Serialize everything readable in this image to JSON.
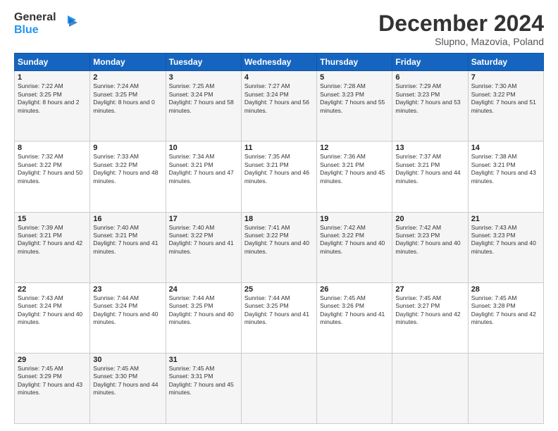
{
  "header": {
    "logo_line1": "General",
    "logo_line2": "Blue",
    "month_title": "December 2024",
    "subtitle": "Slupno, Mazovia, Poland"
  },
  "days_of_week": [
    "Sunday",
    "Monday",
    "Tuesday",
    "Wednesday",
    "Thursday",
    "Friday",
    "Saturday"
  ],
  "weeks": [
    [
      {
        "day": 1,
        "sunrise": "7:22 AM",
        "sunset": "3:25 PM",
        "daylight": "8 hours and 2 minutes."
      },
      {
        "day": 2,
        "sunrise": "7:24 AM",
        "sunset": "3:25 PM",
        "daylight": "8 hours and 0 minutes."
      },
      {
        "day": 3,
        "sunrise": "7:25 AM",
        "sunset": "3:24 PM",
        "daylight": "7 hours and 58 minutes."
      },
      {
        "day": 4,
        "sunrise": "7:27 AM",
        "sunset": "3:24 PM",
        "daylight": "7 hours and 56 minutes."
      },
      {
        "day": 5,
        "sunrise": "7:28 AM",
        "sunset": "3:23 PM",
        "daylight": "7 hours and 55 minutes."
      },
      {
        "day": 6,
        "sunrise": "7:29 AM",
        "sunset": "3:23 PM",
        "daylight": "7 hours and 53 minutes."
      },
      {
        "day": 7,
        "sunrise": "7:30 AM",
        "sunset": "3:22 PM",
        "daylight": "7 hours and 51 minutes."
      }
    ],
    [
      {
        "day": 8,
        "sunrise": "7:32 AM",
        "sunset": "3:22 PM",
        "daylight": "7 hours and 50 minutes."
      },
      {
        "day": 9,
        "sunrise": "7:33 AM",
        "sunset": "3:22 PM",
        "daylight": "7 hours and 48 minutes."
      },
      {
        "day": 10,
        "sunrise": "7:34 AM",
        "sunset": "3:21 PM",
        "daylight": "7 hours and 47 minutes."
      },
      {
        "day": 11,
        "sunrise": "7:35 AM",
        "sunset": "3:21 PM",
        "daylight": "7 hours and 46 minutes."
      },
      {
        "day": 12,
        "sunrise": "7:36 AM",
        "sunset": "3:21 PM",
        "daylight": "7 hours and 45 minutes."
      },
      {
        "day": 13,
        "sunrise": "7:37 AM",
        "sunset": "3:21 PM",
        "daylight": "7 hours and 44 minutes."
      },
      {
        "day": 14,
        "sunrise": "7:38 AM",
        "sunset": "3:21 PM",
        "daylight": "7 hours and 43 minutes."
      }
    ],
    [
      {
        "day": 15,
        "sunrise": "7:39 AM",
        "sunset": "3:21 PM",
        "daylight": "7 hours and 42 minutes."
      },
      {
        "day": 16,
        "sunrise": "7:40 AM",
        "sunset": "3:21 PM",
        "daylight": "7 hours and 41 minutes."
      },
      {
        "day": 17,
        "sunrise": "7:40 AM",
        "sunset": "3:22 PM",
        "daylight": "7 hours and 41 minutes."
      },
      {
        "day": 18,
        "sunrise": "7:41 AM",
        "sunset": "3:22 PM",
        "daylight": "7 hours and 40 minutes."
      },
      {
        "day": 19,
        "sunrise": "7:42 AM",
        "sunset": "3:22 PM",
        "daylight": "7 hours and 40 minutes."
      },
      {
        "day": 20,
        "sunrise": "7:42 AM",
        "sunset": "3:23 PM",
        "daylight": "7 hours and 40 minutes."
      },
      {
        "day": 21,
        "sunrise": "7:43 AM",
        "sunset": "3:23 PM",
        "daylight": "7 hours and 40 minutes."
      }
    ],
    [
      {
        "day": 22,
        "sunrise": "7:43 AM",
        "sunset": "3:24 PM",
        "daylight": "7 hours and 40 minutes."
      },
      {
        "day": 23,
        "sunrise": "7:44 AM",
        "sunset": "3:24 PM",
        "daylight": "7 hours and 40 minutes."
      },
      {
        "day": 24,
        "sunrise": "7:44 AM",
        "sunset": "3:25 PM",
        "daylight": "7 hours and 40 minutes."
      },
      {
        "day": 25,
        "sunrise": "7:44 AM",
        "sunset": "3:25 PM",
        "daylight": "7 hours and 41 minutes."
      },
      {
        "day": 26,
        "sunrise": "7:45 AM",
        "sunset": "3:26 PM",
        "daylight": "7 hours and 41 minutes."
      },
      {
        "day": 27,
        "sunrise": "7:45 AM",
        "sunset": "3:27 PM",
        "daylight": "7 hours and 42 minutes."
      },
      {
        "day": 28,
        "sunrise": "7:45 AM",
        "sunset": "3:28 PM",
        "daylight": "7 hours and 42 minutes."
      }
    ],
    [
      {
        "day": 29,
        "sunrise": "7:45 AM",
        "sunset": "3:29 PM",
        "daylight": "7 hours and 43 minutes."
      },
      {
        "day": 30,
        "sunrise": "7:45 AM",
        "sunset": "3:30 PM",
        "daylight": "7 hours and 44 minutes."
      },
      {
        "day": 31,
        "sunrise": "7:45 AM",
        "sunset": "3:31 PM",
        "daylight": "7 hours and 45 minutes."
      },
      null,
      null,
      null,
      null
    ]
  ]
}
